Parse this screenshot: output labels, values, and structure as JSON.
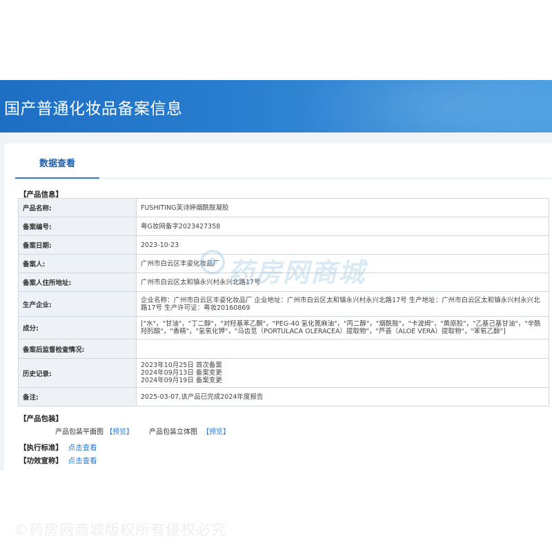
{
  "header": {
    "title": "国产普通化妆品备案信息"
  },
  "tabs": [
    {
      "label": "数据查看"
    }
  ],
  "sections": {
    "product_info": "【产品信息】",
    "package": "【产品包装】",
    "standard": "【执行标准】",
    "efficacy": "【功效宣称】"
  },
  "product_info": [
    {
      "label": "产品名称:",
      "value": "FUSHITING芙诗婷烟酰胺凝胶"
    },
    {
      "label": "备案编号:",
      "value": "粤G妆网备字2023427358"
    },
    {
      "label": "备案日期:",
      "value": "2023-10-23"
    },
    {
      "label": "备案人:",
      "value": "广州市白云区丰姿化妆品厂"
    },
    {
      "label": "备案人住所地址:",
      "value": "广州市白云区太和镇永兴村永兴北路17号"
    },
    {
      "label": "生产企业:",
      "value": "企业名称：广州市白云区丰姿化妆品厂 企业地址：广州市白云区太和镇永兴村永兴北路17号 生产地址：广州市白云区太和镇永兴村永兴北路17号 生产许可证：粤妆20160869"
    },
    {
      "label": "成分:",
      "value": "[\"水\"，\"甘油\"，\"丁二醇\"，\"对羟基苯乙酮\"，\"PEG-40 氢化蓖麻油\"，\"丙二醇\"，\"烟酰胺\"，\"卡波姆\"，\"黄原胶\"，\"乙基己基甘油\"，\"辛酰羟肟酸\"，\"香精\"，\"氢氧化钾\"，\"马齿苋（PORTULACA OLERACEA）提取物\"，\"芦荟（ALOE VERA）提取物\"，\"苯氧乙醇\"]"
    },
    {
      "label": "备案后监督检查情况:",
      "value": ""
    },
    {
      "label": "历史记录:",
      "value": "2023年10月25日 首次备案\n2024年09月13日 备案变更\n2024年09月19日 备案变更"
    },
    {
      "label": "备注:",
      "value": "2025-03-07,该产品已完成2024年度报告"
    }
  ],
  "package": {
    "flat_label": "产品包装平面图",
    "flat_link": "【预览】",
    "solid_label": "产品包装立体图",
    "solid_link": "【预览】"
  },
  "standard_link": "点击查看",
  "efficacy_link": "点击查看",
  "watermark": "药房网商城",
  "copyright": "©药房网商城版权所有侵权必究"
}
